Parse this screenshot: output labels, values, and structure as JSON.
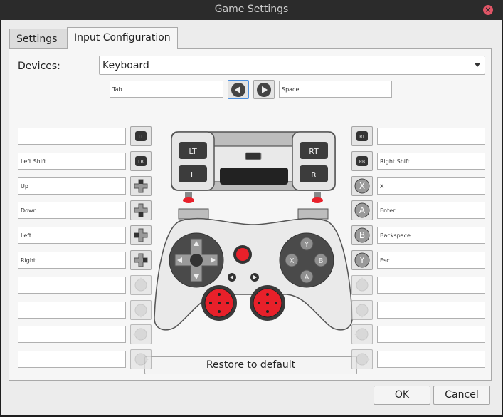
{
  "window": {
    "title": "Game Settings"
  },
  "tabs": [
    {
      "label": "Settings"
    },
    {
      "label": "Input Configuration"
    }
  ],
  "devices": {
    "label": "Devices:",
    "value": "Keyboard"
  },
  "nav": {
    "prev_field": "Tab",
    "next_field": "Space"
  },
  "left_fields": [
    "",
    "Left Shift",
    "Up",
    "Down",
    "Left",
    "Right",
    "",
    "",
    "",
    ""
  ],
  "right_fields": [
    "",
    "Right Shift",
    "X",
    "Enter",
    "Backspace",
    "Esc",
    "",
    "",
    "",
    ""
  ],
  "left_icons": [
    "LT",
    "LB",
    "dpad-up",
    "dpad-down",
    "dpad-left",
    "dpad-right",
    "stick-up",
    "stick-down",
    "stick-left",
    "stick-right"
  ],
  "right_icons": [
    "RT",
    "RB",
    "X",
    "A",
    "B",
    "Y",
    "stick-up",
    "stick-down",
    "stick-left",
    "stick-right"
  ],
  "controller": {
    "lt": "LT",
    "rt": "RT",
    "lb": "L",
    "rb": "R",
    "y": "Y",
    "x": "X",
    "b": "B",
    "a": "A"
  },
  "colors": {
    "accent_red": "#e8202a",
    "selection_blue": "#4a8fe0"
  },
  "actions": {
    "restore": "Restore to default",
    "ok": "OK",
    "cancel": "Cancel"
  }
}
